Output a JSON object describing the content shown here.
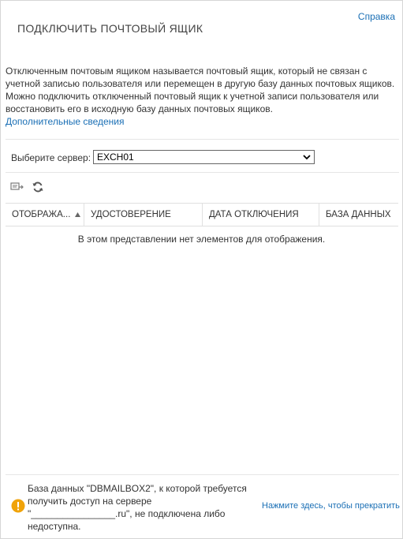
{
  "header": {
    "help_link": "Справка",
    "title": "ПОДКЛЮЧИТЬ ПОЧТОВЫЙ ЯЩИК"
  },
  "description": {
    "text": "Отключенным почтовым ящиком называется почтовый ящик, который не связан с учетной записью пользователя или перемещен в другую базу данных почтовых ящиков. Можно подключить отключенный почтовый ящик к учетной записи пользователя или восстановить его в исходную базу данных почтовых ящиков.",
    "more_link": "Дополнительные сведения"
  },
  "server": {
    "label": "Выберите сервер:",
    "selected": "EXCH01"
  },
  "toolbar": {
    "icons": [
      "connect-mailbox-icon",
      "refresh-icon"
    ]
  },
  "table": {
    "columns": [
      "ОТОБРАЖА...",
      "УДОСТОВЕРЕНИЕ",
      "ДАТА ОТКЛЮЧЕНИЯ",
      "БАЗА ДАННЫХ"
    ],
    "sorted_column": 0,
    "sort_direction": "ascending",
    "empty_message": "В этом представлении нет элементов для отображения."
  },
  "notice": {
    "text": "База данных \"DBMAILBOX2\", к которой требуется получить доступ на сервере \"________________.ru\", не подключена либо недоступна.",
    "stop_link": "Нажмите здесь, чтобы прекратить",
    "icon": "warning-icon",
    "icon_color": "#f0a30a"
  },
  "colors": {
    "link": "#1a6fb5",
    "text": "#333333",
    "border": "#d6d6d6"
  }
}
